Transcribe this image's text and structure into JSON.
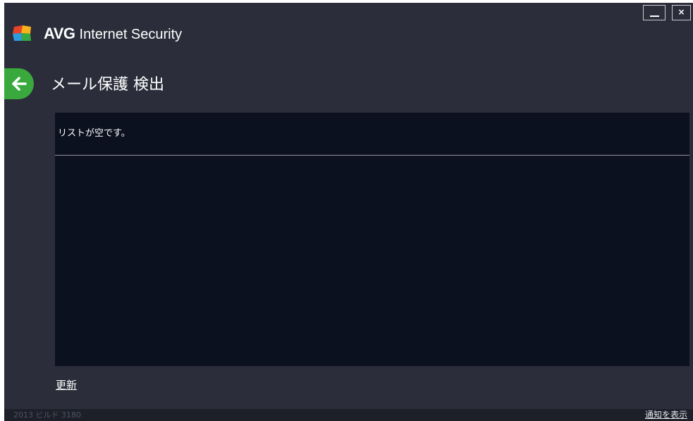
{
  "window": {
    "minimize_label": "—",
    "close_label": "×"
  },
  "header": {
    "brand": "AVG",
    "product": "Internet Security",
    "logo_icon": "avg-logo-icon"
  },
  "page": {
    "back_icon": "arrow-left-icon",
    "title": "メール保護 検出"
  },
  "list": {
    "empty_message": "リストが空です。"
  },
  "actions": {
    "refresh_label": "更新"
  },
  "footer": {
    "build_info": "2013 ビルド 3180",
    "show_notifications_label": "通知を表示"
  },
  "colors": {
    "window_bg": "#2b2d3a",
    "panel_bg": "#0c1120",
    "accent_green": "#3aa93d",
    "footer_bg": "#1d1f29"
  }
}
